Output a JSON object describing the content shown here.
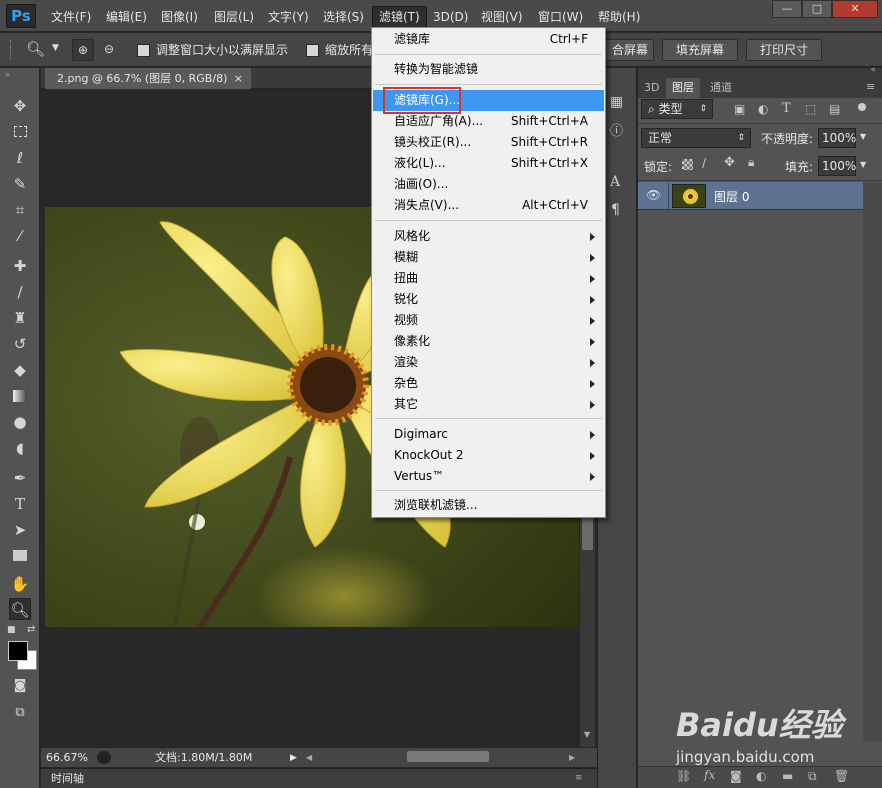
{
  "app": {
    "logo": "Ps",
    "menubar": [
      "文件(F)",
      "编辑(E)",
      "图像(I)",
      "图层(L)",
      "文字(Y)",
      "选择(S)",
      "滤镜(T)",
      "3D(D)",
      "视图(V)",
      "窗口(W)",
      "帮助(H)"
    ],
    "window_controls": {
      "minimize": "—",
      "restore": "□",
      "close": "✕"
    }
  },
  "options": {
    "resize_window_label": "调整窗口大小以满屏显示",
    "zoom_all_label": "缩放所有",
    "fit_screen_label": "合屏幕",
    "fill_screen_label": "填充屏幕",
    "print_size_label": "打印尺寸"
  },
  "document": {
    "tab_title": "2.png @ 66.7% (图层 0, RGB/8)",
    "tab_close": "×",
    "zoom": "66.67%",
    "doc_info": "文档:1.80M/1.80M",
    "timeline_label": "时间轴"
  },
  "panels": {
    "tabs": [
      "3D",
      "图层",
      "通道"
    ],
    "active_tab": "图层",
    "filter_kind": "类型",
    "blend_mode": "正常",
    "opacity_label": "不透明度:",
    "opacity_value": "100%",
    "lock_label": "锁定:",
    "fill_label": "填充:",
    "fill_value": "100%",
    "layers": [
      {
        "name": "图层 0",
        "visible": true
      }
    ]
  },
  "filter_menu": {
    "top": [
      {
        "label": "滤镜库",
        "shortcut": "Ctrl+F"
      }
    ],
    "convert": {
      "label": "转换为智能滤镜"
    },
    "main": [
      {
        "label": "滤镜库(G)...",
        "shortcut": "",
        "highlighted": true
      },
      {
        "label": "自适应广角(A)...",
        "shortcut": "Shift+Ctrl+A"
      },
      {
        "label": "镜头校正(R)...",
        "shortcut": "Shift+Ctrl+R"
      },
      {
        "label": "液化(L)...",
        "shortcut": "Shift+Ctrl+X"
      },
      {
        "label": "油画(O)...",
        "shortcut": ""
      },
      {
        "label": "消失点(V)...",
        "shortcut": "Alt+Ctrl+V"
      }
    ],
    "groups": [
      "风格化",
      "模糊",
      "扭曲",
      "锐化",
      "视频",
      "像素化",
      "渲染",
      "杂色",
      "其它"
    ],
    "plugins": [
      "Digimarc",
      "KnockOut 2",
      "Vertus™"
    ],
    "browse": {
      "label": "浏览联机滤镜..."
    }
  },
  "colors": {
    "highlight": "#3d97f0",
    "annotation_box": "#e0302a",
    "layer_selected": "#5d7291"
  },
  "watermark": {
    "brand": "Baidu经验",
    "url": "jingyan.baidu.com"
  }
}
